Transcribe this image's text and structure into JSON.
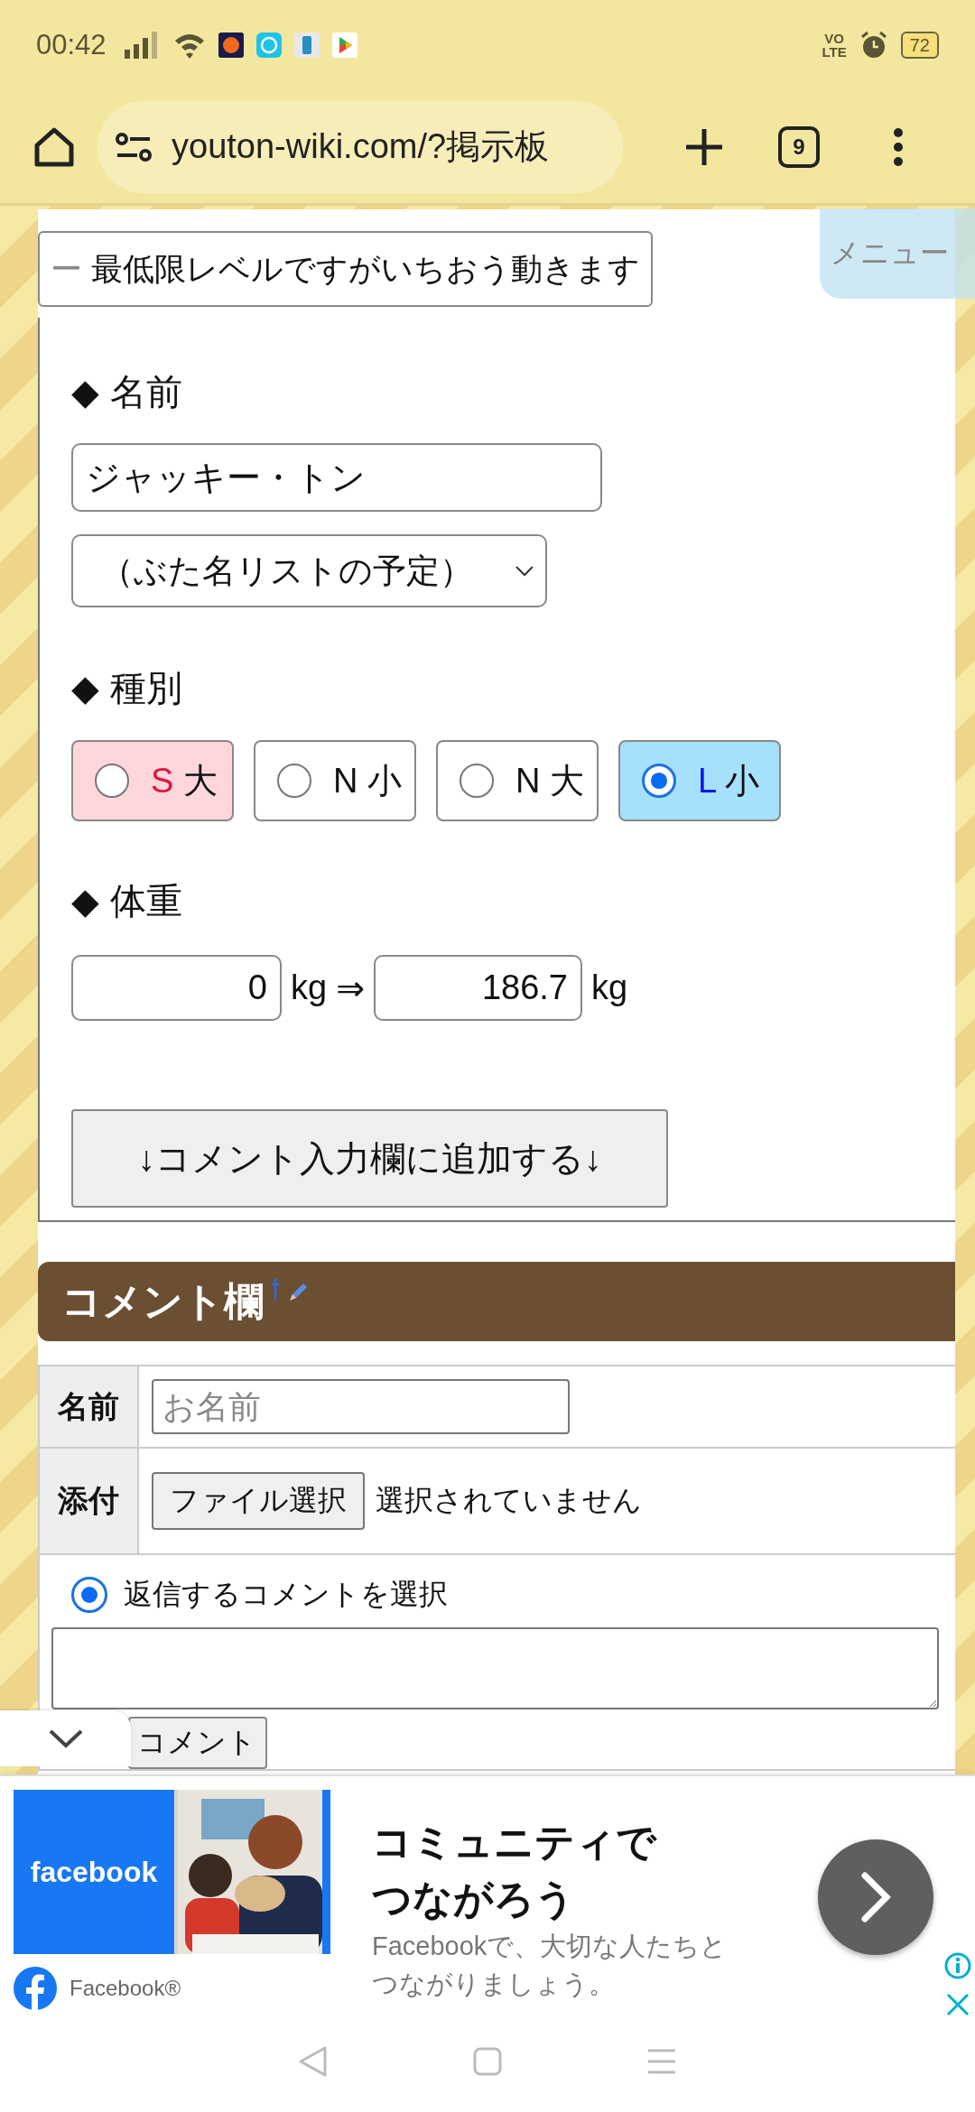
{
  "status_bar": {
    "time": "00:42",
    "network": [
      "VO",
      "LTE"
    ],
    "battery": "72"
  },
  "browser": {
    "url": "youton-wiki.com/?掲示板",
    "tab_count": "9"
  },
  "notice": {
    "mark": "ー",
    "text": "最低限レベルですがいちおう動きます"
  },
  "menu_tab": "メニュー",
  "name_section": {
    "marker": "◆",
    "heading": "名前",
    "value": "ジャッキー・トン",
    "select": "（ぶた名リストの予定）"
  },
  "type_section": {
    "marker": "◆",
    "heading": "種別",
    "options": [
      {
        "prefix": {
          "text": "S",
          "color": "#e0143c"
        },
        "label": "大",
        "selected": false,
        "color": "#ffd6dc"
      },
      {
        "prefix": {
          "text": "N",
          "color": "#111111"
        },
        "label": "小",
        "selected": false,
        "color": "#ffffff"
      },
      {
        "prefix": {
          "text": "N",
          "color": "#111111"
        },
        "label": "大",
        "selected": false,
        "color": "#ffffff"
      },
      {
        "prefix": {
          "text": "L",
          "color": "#0a14e6"
        },
        "label": "小",
        "selected": true,
        "color": "#a6e1fc"
      }
    ]
  },
  "weight_section": {
    "marker": "◆",
    "heading": "体重",
    "from": "0",
    "from_unit": "kg",
    "arrow": "⇒",
    "to": "186.7",
    "to_unit": "kg"
  },
  "add_button": "↓コメント入力欄に追加する↓",
  "comment": {
    "heading": "コメント欄",
    "name_label": "名前",
    "name_placeholder": "お名前",
    "attach_label": "添付",
    "file_button": "ファイル選択",
    "file_status": "選択されていません",
    "reply": {
      "label": "返信するコメントを選択",
      "selected": true
    },
    "submit": "コメント"
  },
  "ad": {
    "brand_tile": "facebook",
    "title": [
      "コミュニティで",
      "つながろう"
    ],
    "body": [
      "Facebookで、大切な人たちと",
      "つながりましょう。"
    ],
    "advertiser": "Facebook®"
  }
}
